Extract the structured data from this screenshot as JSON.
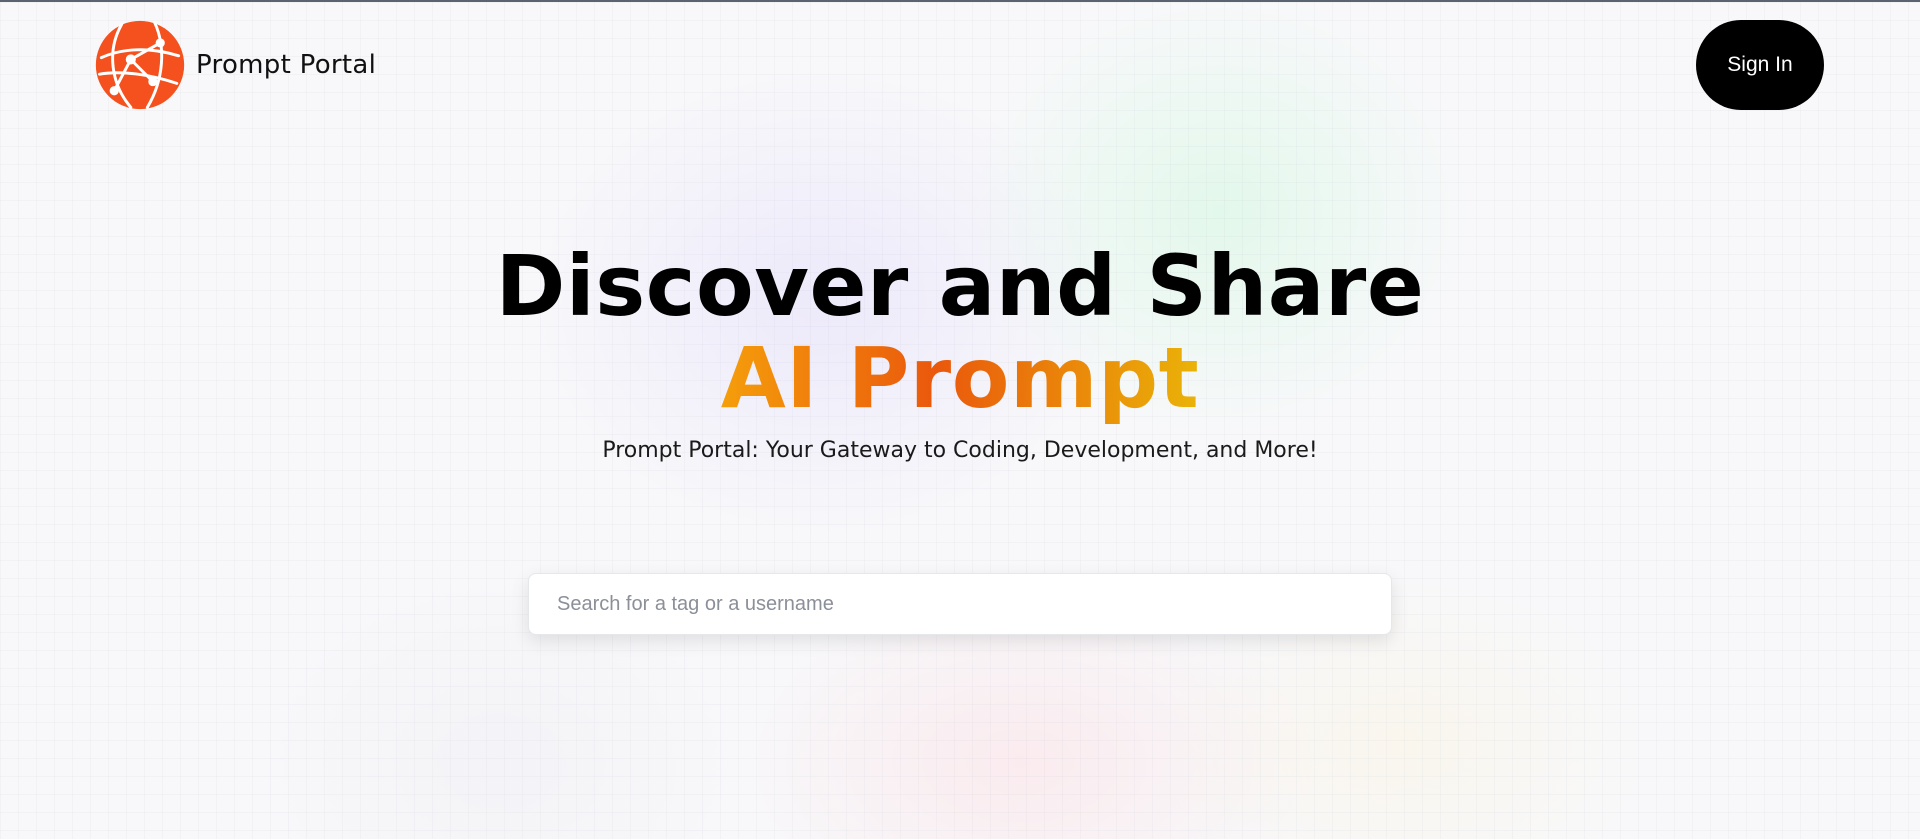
{
  "brand": {
    "name": "Prompt Portal",
    "logo_icon": "globe-network-icon",
    "logo_color": "#f4511e"
  },
  "nav": {
    "sign_in_label": "Sign In"
  },
  "hero": {
    "title": "Discover and Share",
    "highlight": "AI Prompt",
    "subtitle": "Prompt Portal: Your Gateway to Coding, Development, and More!",
    "highlight_gradient": [
      "#f59e0b",
      "#ea580c",
      "#eab308"
    ]
  },
  "search": {
    "placeholder": "Search for a tag or a username",
    "value": ""
  }
}
